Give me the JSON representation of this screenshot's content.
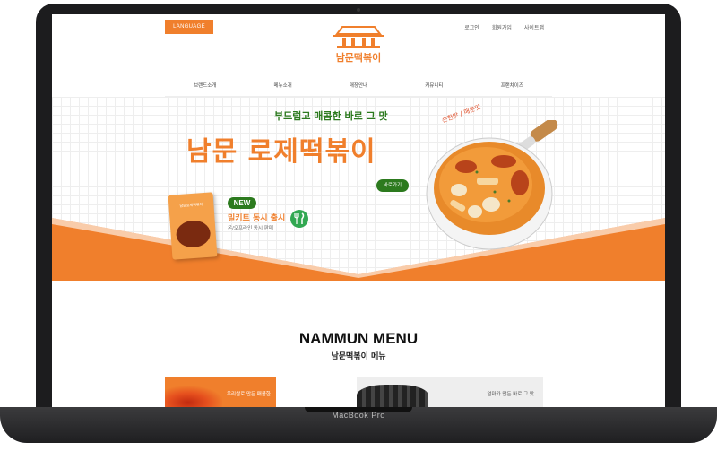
{
  "device": {
    "label": "MacBook Pro"
  },
  "header": {
    "language_label": "LANGUAGE",
    "top_links": [
      "로그인",
      "회원가입",
      "사이트맵"
    ],
    "logo_text": "남문떡볶이"
  },
  "nav": {
    "items": [
      "브랜드소개",
      "메뉴소개",
      "매장안내",
      "커뮤니티",
      "프랜차이즈"
    ]
  },
  "hero": {
    "subtitle": "부드럽고 매콤한 바로 그 맛",
    "title": "남문 로제떡볶이",
    "go_button": "바로가기",
    "spice_text": "순한맛 / 매운맛",
    "new_badge": "NEW",
    "new_text": "밀키트 동시 출시",
    "new_sub": "온/오프라인 동시 판매",
    "package_label": "남문로제떡볶이"
  },
  "menu": {
    "title": "NAMMUN MENU",
    "subtitle": "남문떡볶이 메뉴",
    "cards": [
      {
        "text": "우리쌀로 만든 매콤한"
      },
      {
        "text": "엄마가 만든 바로 그 맛"
      }
    ]
  },
  "colors": {
    "accent": "#f07f2c",
    "green": "#2c7a1e"
  }
}
